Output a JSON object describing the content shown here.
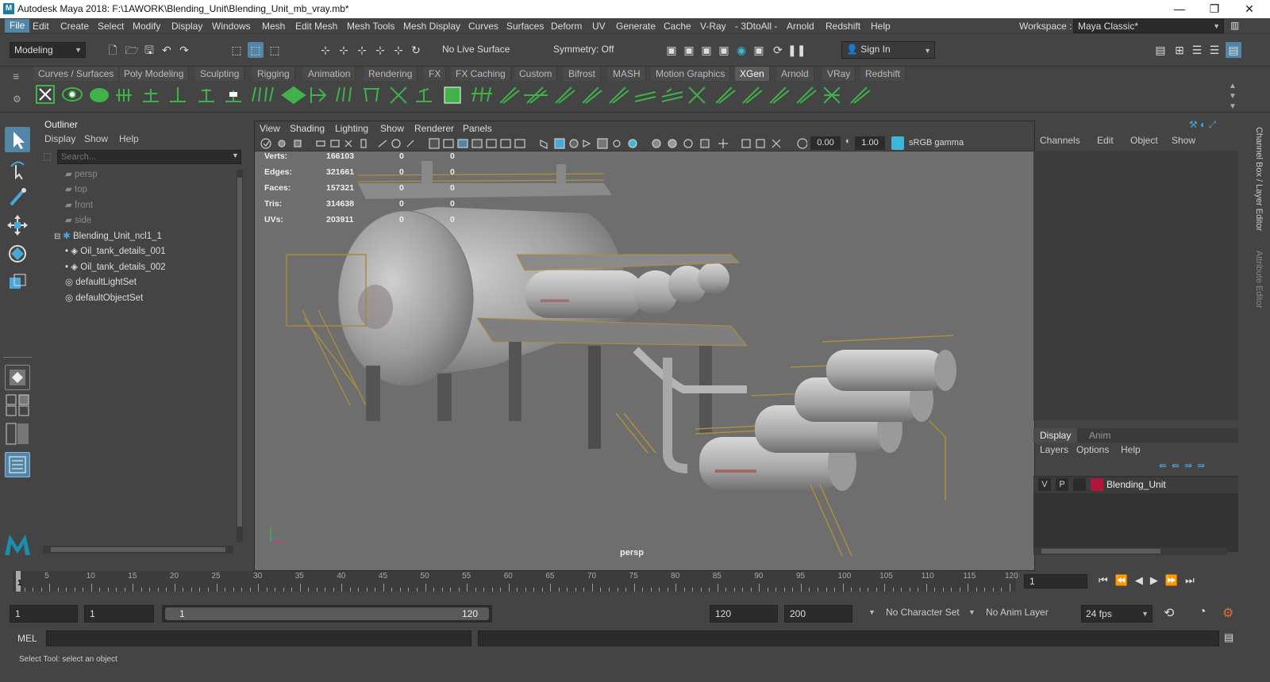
{
  "window": {
    "title": "Autodesk Maya 2018: F:\\1AWORK\\Blending_Unit\\Blending_Unit_mb_vray.mb*",
    "minimize": "—",
    "maximize": "❐",
    "close": "✕"
  },
  "menubar": {
    "items": [
      "File",
      "Edit",
      "Create",
      "Select",
      "Modify",
      "Display",
      "Windows",
      "Mesh",
      "Edit Mesh",
      "Mesh Tools",
      "Mesh Display",
      "Curves",
      "Surfaces",
      "Deform",
      "UV",
      "Generate",
      "Cache",
      "V-Ray",
      "- 3DtoAll -",
      "Arnold",
      "Redshift",
      "Help"
    ],
    "workspace_label": "Workspace :",
    "workspace_value": "Maya Classic*"
  },
  "statusline": {
    "mode": "Modeling",
    "live_surface": "No Live Surface",
    "symmetry": "Symmetry: Off",
    "sign_in": "Sign In"
  },
  "shelf": {
    "tabs": [
      "Curves / Surfaces",
      "Poly Modeling",
      "Sculpting",
      "Rigging",
      "Animation",
      "Rendering",
      "FX",
      "FX Caching",
      "Custom",
      "Bifrost",
      "MASH",
      "Motion Graphics",
      "XGen",
      "Arnold",
      "VRay",
      "Redshift"
    ],
    "active_tab": "XGen"
  },
  "outliner": {
    "title": "Outliner",
    "menu": [
      "Display",
      "Show",
      "Help"
    ],
    "search_placeholder": "Search...",
    "items": [
      {
        "label": "persp",
        "dim": true
      },
      {
        "label": "top",
        "dim": true
      },
      {
        "label": "front",
        "dim": true
      },
      {
        "label": "side",
        "dim": true
      },
      {
        "label": "Blending_Unit_ncl1_1",
        "dim": false
      },
      {
        "label": "Oil_tank_details_001",
        "dim": false
      },
      {
        "label": "Oil_tank_details_002",
        "dim": false
      },
      {
        "label": "defaultLightSet",
        "dim": false
      },
      {
        "label": "defaultObjectSet",
        "dim": false
      }
    ]
  },
  "viewport": {
    "menu": [
      "View",
      "Shading",
      "Lighting",
      "Show",
      "Renderer",
      "Panels"
    ],
    "exposure": "0.00",
    "gamma": "1.00",
    "color_space": "sRGB gamma",
    "camera_label": "persp",
    "stats": [
      {
        "label": "Verts:",
        "v1": "166103",
        "v2": "0",
        "v3": "0"
      },
      {
        "label": "Edges:",
        "v1": "321661",
        "v2": "0",
        "v3": "0"
      },
      {
        "label": "Faces:",
        "v1": "157321",
        "v2": "0",
        "v3": "0"
      },
      {
        "label": "Tris:",
        "v1": "314638",
        "v2": "0",
        "v3": "0"
      },
      {
        "label": "UVs:",
        "v1": "203911",
        "v2": "0",
        "v3": "0"
      }
    ]
  },
  "channel_box": {
    "menu": [
      "Channels",
      "Edit",
      "Object",
      "Show"
    ],
    "side_tab_1": "Channel Box / Layer Editor",
    "side_tab_2": "Attribute Editor",
    "layer_tabs": [
      "Display",
      "Anim"
    ],
    "layer_menu": [
      "Layers",
      "Options",
      "Help"
    ],
    "layer": {
      "v": "V",
      "p": "P",
      "name": "Blending_Unit",
      "color": "#b0153a"
    }
  },
  "timeline": {
    "ticks": [
      "5",
      "10",
      "15",
      "20",
      "25",
      "30",
      "35",
      "40",
      "45",
      "50",
      "55",
      "60",
      "65",
      "70",
      "75",
      "80",
      "85",
      "90",
      "95",
      "100",
      "105",
      "110",
      "115",
      "120"
    ],
    "current_frame": "1",
    "current_field": "1"
  },
  "range": {
    "start": "1",
    "playback_start": "1",
    "slider_start": "1",
    "slider_end": "120",
    "playback_end": "120",
    "end": "200",
    "character_set": "No Character Set",
    "anim_layer": "No Anim Layer",
    "fps": "24 fps"
  },
  "command": {
    "label": "MEL"
  },
  "help_line": "Select Tool: select an object",
  "colors": {
    "accent": "#5285a6",
    "shelf_green": "#3fb24a",
    "layer_red": "#b0153a"
  }
}
